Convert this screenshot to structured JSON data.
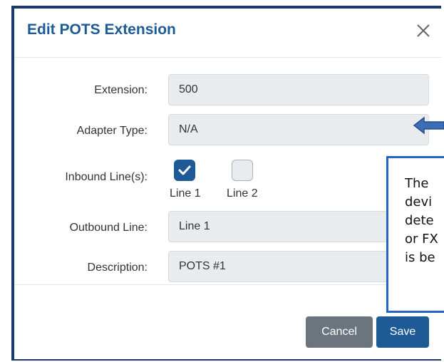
{
  "dialog": {
    "title": "Edit POTS Extension",
    "close_icon": "close-icon"
  },
  "form": {
    "extension": {
      "label": "Extension:",
      "value": "500"
    },
    "adapter_type": {
      "label": "Adapter Type:",
      "value": "N/A"
    },
    "inbound_lines": {
      "label": "Inbound Line(s):",
      "options": [
        {
          "label": "Line 1",
          "checked": true
        },
        {
          "label": "Line 2",
          "checked": false
        }
      ]
    },
    "outbound_line": {
      "label": "Outbound Line:",
      "value": "Line 1"
    },
    "description": {
      "label": "Description:",
      "value": "POTS #1"
    }
  },
  "footer": {
    "cancel_label": "Cancel",
    "save_label": "Save"
  },
  "annotation": {
    "arrow_icon": "left-arrow-icon",
    "lines": [
      "The",
      "devi",
      "dete",
      "or FX",
      "is be"
    ]
  },
  "colors": {
    "accent": "#1e5a96",
    "cancel": "#6c757d",
    "field_bg": "#e9ecef",
    "annotation_border": "#2264c8"
  }
}
